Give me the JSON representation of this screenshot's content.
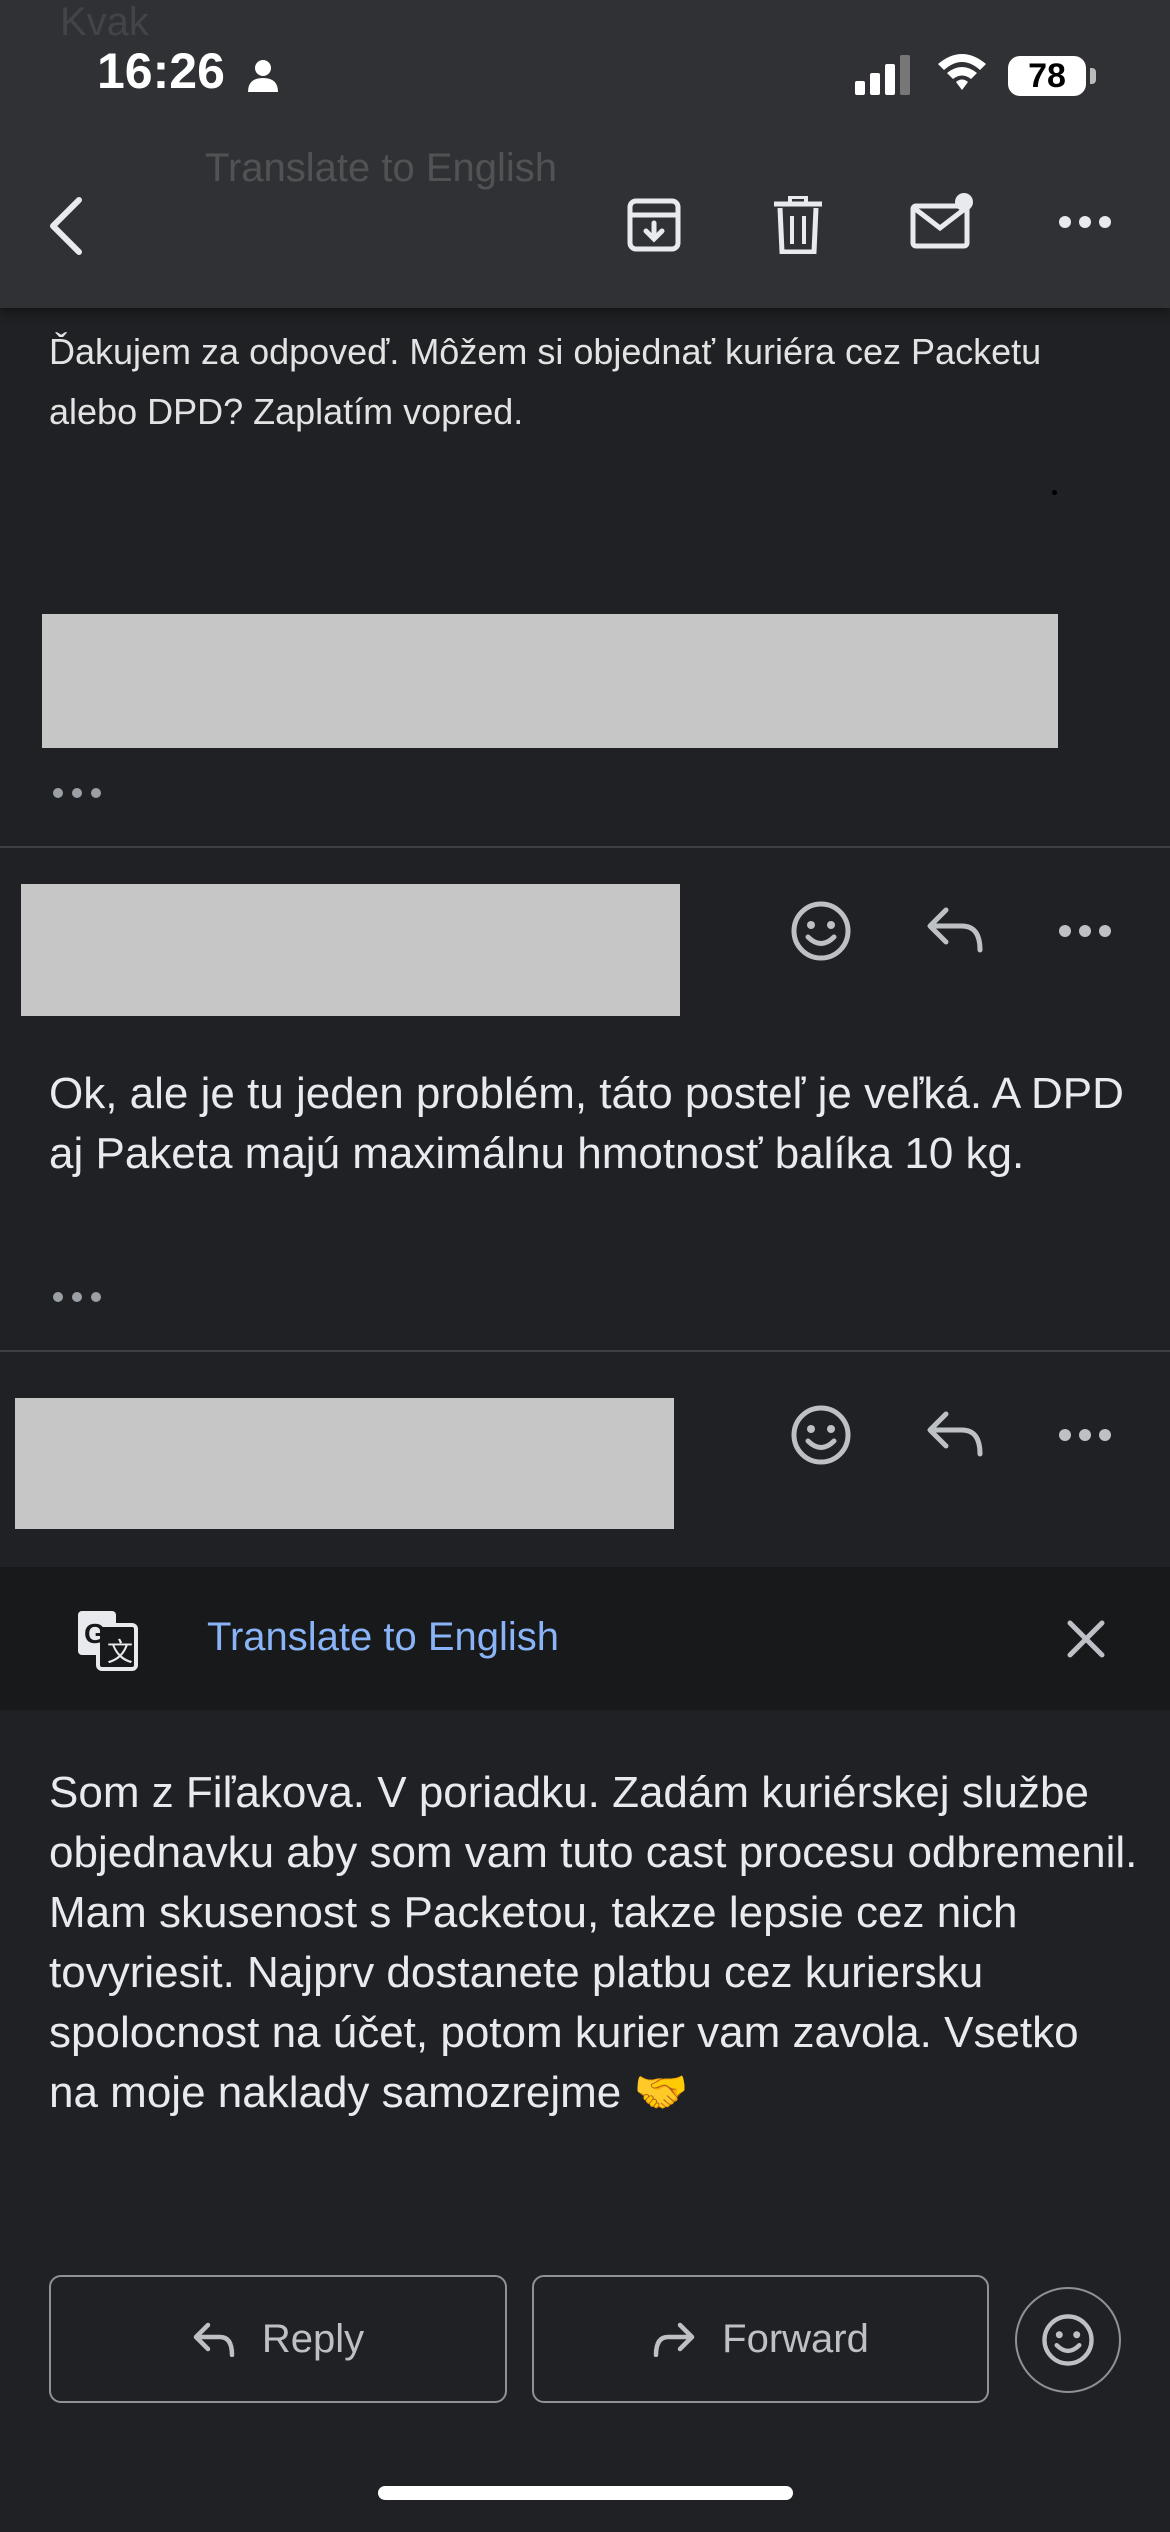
{
  "status_bar": {
    "time": "16:26",
    "battery": "78"
  },
  "ghost": {
    "translate_label": "Translate to English",
    "top_text": "Kvak"
  },
  "toolbar": {
    "icons": [
      "back-arrow-icon",
      "archive-icon",
      "trash-icon",
      "mark-unread-icon",
      "more-icon"
    ]
  },
  "quoted_message": {
    "text": "Ďakujem za odpoveď. Môžem si objednať kuriéra cez Packetu alebo DPD? Zaplatím vopred."
  },
  "message_2": {
    "body": "Ok, ale je tu jeden problém, táto posteľ je veľká. A DPD aj Paketa majú maximálnu hmotnosť balíka 10 kg."
  },
  "translate_bar": {
    "label": "Translate to English"
  },
  "message_3": {
    "body": "Som z Fiľakova. V poriadku. Zadám kuriérskej službe objednavku aby som vam tuto cast procesu odbremenil.\nMam skusenost s Packetou, takze lepsie cez nich tovyriesit. Najprv dostanete platbu cez kuriersku spolocnost na účet, potom kurier vam zavola. Vsetko na moje naklady samozrejme 🤝"
  },
  "actions": {
    "reply_label": "Reply",
    "forward_label": "Forward"
  },
  "colors": {
    "background": "#202124",
    "toolbar": "#303134",
    "link": "#8ab4f8",
    "redaction": "#c6c6c6"
  }
}
